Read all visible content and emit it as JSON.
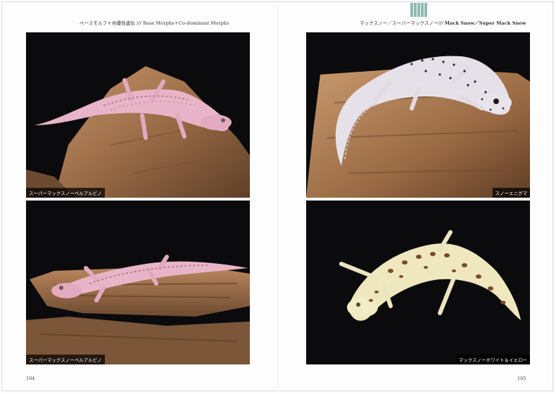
{
  "left_page": {
    "running_head": {
      "jp": "ベースモルフ＋共優性遺伝",
      "sep": " ///",
      "en": " Base Morphs＋Co-dominant Morphs"
    },
    "photos": [
      {
        "caption": "スーパーマックスノーベルアルビノ"
      },
      {
        "caption": "スーパーマックスノーベルアルビノ"
      }
    ],
    "folio": "104"
  },
  "right_page": {
    "running_head": {
      "jp": "マックスノー／スーパーマックスノー",
      "sep": "/// ",
      "en": "Mack Snow／Super Mack Snow"
    },
    "photos": [
      {
        "caption": "スノーエニグマ"
      },
      {
        "caption": "マックスノーホワイト＆イエロー"
      }
    ],
    "folio": "105"
  },
  "colors": {
    "photo_bg": "#0b0b0d",
    "rock": "#a7774e",
    "gecko_pink": "#e9b7c9",
    "gecko_snow": "#e6e1e8",
    "gecko_yellow": "#efe7bd",
    "tab": "#8fb9b2"
  }
}
